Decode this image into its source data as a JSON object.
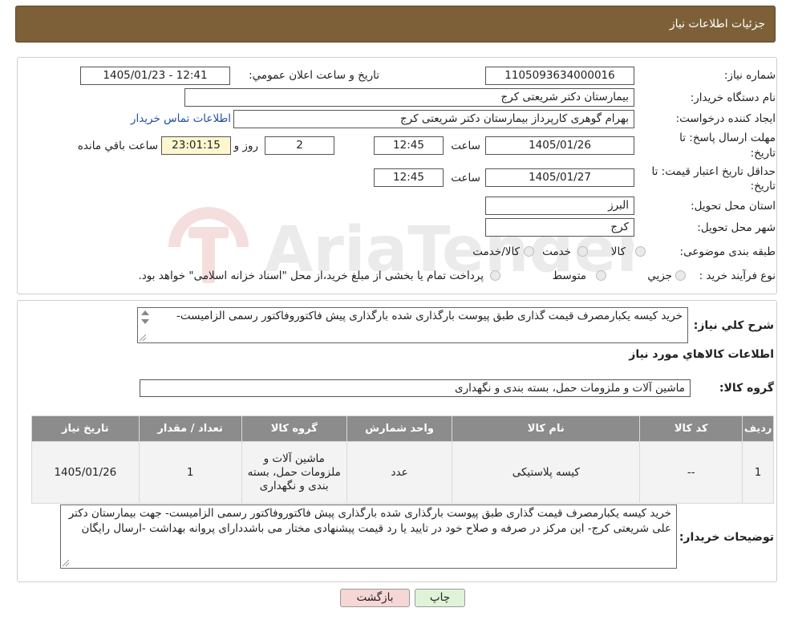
{
  "header": {
    "title": "جزئیات اطلاعات نیاز"
  },
  "watermark": {
    "text": "AriaTender.neT"
  },
  "need_info": {
    "need_number_label": "شماره نیاز:",
    "need_number": "1105093634000016",
    "announce_label": "تاریخ و ساعت اعلان عمومي:",
    "announce_value": "1405/01/23 - 12:41",
    "buyer_org_label": "نام دستگاه خریدار:",
    "buyer_org": "بیمارستان دکتر شریعتی کرج",
    "requester_label": "ایجاد کننده درخواست:",
    "requester": "بهرام گوهری کارپرداز بیمارستان دکتر شریعتی کرج",
    "contact_link": "اطلاعات تماس خریدار",
    "reply_deadline_label_1": "مهلت ارسال پاسخ: تا",
    "reply_deadline_label_2": "تاریخ:",
    "reply_date": "1405/01/26",
    "time_label": "ساعت",
    "reply_time": "12:45",
    "days_value": "2",
    "days_label": "روز و",
    "remaining_time": "23:01:15",
    "remaining_label": "ساعت باقي مانده",
    "price_validity_label_1": "حداقل تاریخ اعتبار قیمت: تا",
    "price_validity_label_2": "تاریخ:",
    "price_validity_date": "1405/01/27",
    "price_validity_time": "12:45",
    "province_label": "استان محل تحویل:",
    "province": "البرز",
    "city_label": "شهر محل تحویل:",
    "city": "کرج",
    "category_label": "طبقه بندی موضوعی:",
    "category_options": [
      "کالا",
      "خدمت",
      "کالا/خدمت"
    ],
    "process_label": "نوع فرآیند خرید :",
    "process_options": [
      "جزيي",
      "متوسط"
    ],
    "process_note": "پرداخت تمام یا بخشی از مبلغ خرید،از محل \"اسناد خزانه اسلامی\" خواهد بود."
  },
  "summary": {
    "label": "شرح كلي نياز:",
    "text": "خرید کیسه یکبارمصرف  قیمت گذاری     طبق پیوست بارگذاری شده بارگذاری پیش فاکتوروفاکتور رسمی الزامیست-"
  },
  "goods": {
    "section_title": "اطلاعات كالاهاي مورد نياز",
    "group_label": "گروه كالا:",
    "group_value": "ماشین آلات و ملزومات حمل، بسته بندی و نگهداری",
    "columns": [
      "ردیف",
      "کد کالا",
      "نام کالا",
      "واحد شمارش",
      "گروه کالا",
      "تعداد / مقدار",
      "تاریخ نیاز"
    ],
    "rows": [
      {
        "row": "1",
        "code": "--",
        "name": "کیسه پلاستیکی",
        "unit": "عدد",
        "group": "ماشین آلات و ملزومات حمل، بسته بندی و نگهداری",
        "qty": "1",
        "date": "1405/01/26"
      }
    ]
  },
  "buyer_notes": {
    "label": "توضیحات خریدار:",
    "text": "خرید کیسه یکبارمصرف   قیمت گذاری     طبق پیوست بارگذاری شده بارگذاری پیش فاکتوروفاکتور رسمی الزامیست- جهت بیمارستان دکتر علی شریعتی کرج- این مرکز در صرفه و صلاح خود در تایید یا رد قیمت پیشنهادی مختار می باشددارای پروانه بهداشت -ارسال رایگان"
  },
  "buttons": {
    "print": "چاپ",
    "back": "بازگشت"
  },
  "colors": {
    "header_bg": "#7d6038",
    "table_header_bg": "#8c8c8c",
    "back_button_bg": "#f7d6d6",
    "print_button_bg": "#dff3d9",
    "highlight_bg": "#fdf6cf",
    "link": "#1f4fa8"
  }
}
